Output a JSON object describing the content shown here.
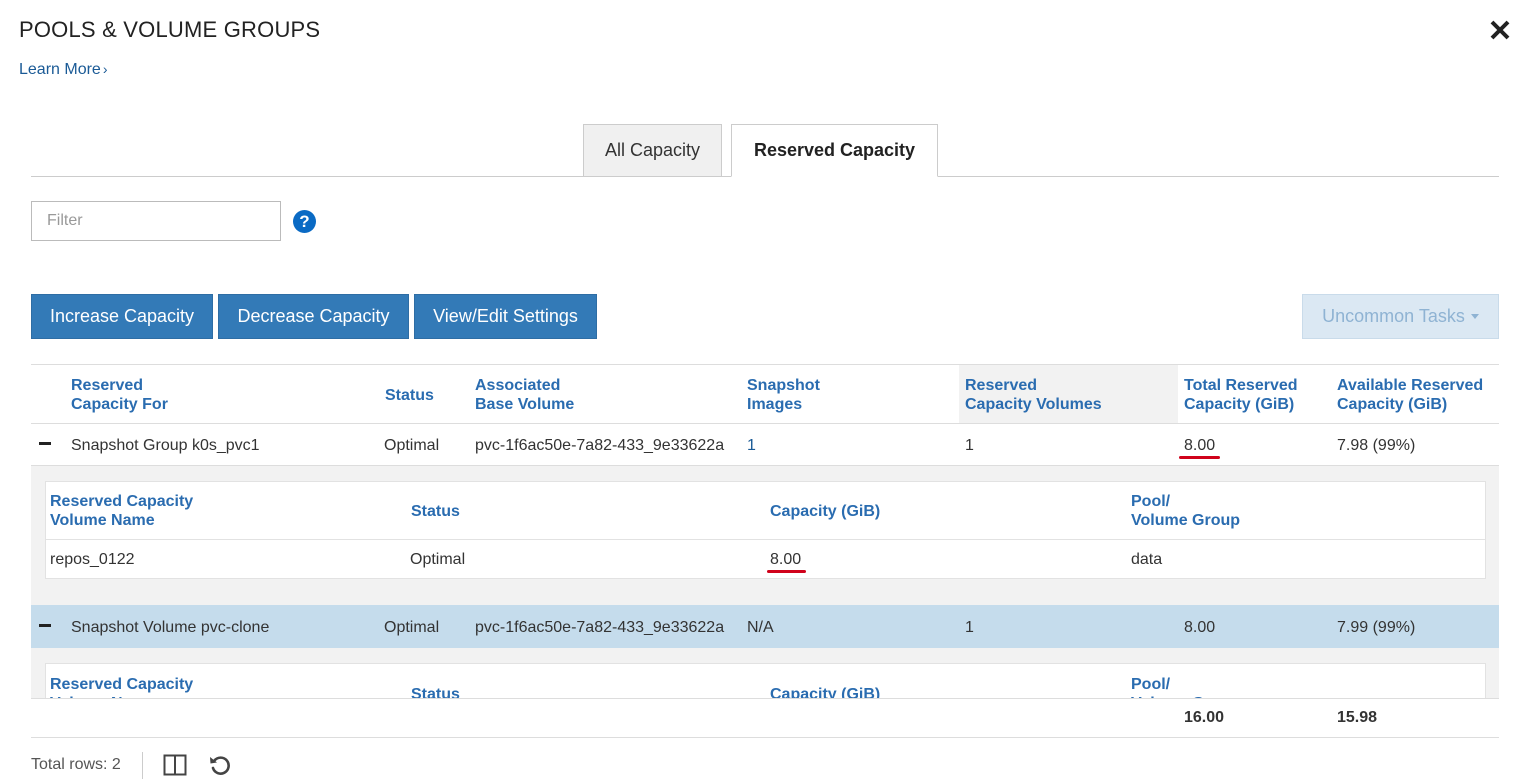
{
  "header": {
    "title": "POOLS & VOLUME GROUPS",
    "learn_more": "Learn More",
    "learn_more_chevron": "›"
  },
  "tabs": [
    {
      "label": "All Capacity",
      "active": false
    },
    {
      "label": "Reserved Capacity",
      "active": true
    }
  ],
  "filter": {
    "placeholder": "Filter",
    "value": ""
  },
  "help_icon_label": "?",
  "toolbar": {
    "increase": "Increase Capacity",
    "decrease": "Decrease Capacity",
    "view_edit": "View/Edit Settings",
    "uncommon": "Uncommon Tasks"
  },
  "table": {
    "columns": [
      {
        "line1": "Reserved",
        "line2": "Capacity For"
      },
      {
        "line1": "Status",
        "line2": ""
      },
      {
        "line1": "Associated",
        "line2": "Base Volume"
      },
      {
        "line1": "Snapshot",
        "line2": "Images"
      },
      {
        "line1": "Reserved",
        "line2": "Capacity Volumes"
      },
      {
        "line1": "Total Reserved",
        "line2": "Capacity (GiB)"
      },
      {
        "line1": "Available Reserved",
        "line2": "Capacity (GiB)"
      }
    ],
    "rows": [
      {
        "expanded": true,
        "capacity_for": "Snapshot Group k0s_pvc1",
        "status": "Optimal",
        "base_volume": "pvc-1f6ac50e-7a82-433_9e33622a",
        "snapshot_images": "1",
        "capacity_volumes": "1",
        "total_reserved": "8.00",
        "available_reserved": "7.98 (99%)"
      },
      {
        "expanded": true,
        "capacity_for": "Snapshot Volume pvc-clone",
        "status": "Optimal",
        "base_volume": "pvc-1f6ac50e-7a82-433_9e33622a",
        "snapshot_images": "N/A",
        "capacity_volumes": "1",
        "total_reserved": "8.00",
        "available_reserved": "7.99 (99%)"
      }
    ],
    "detail": {
      "columns": [
        {
          "line1": "Reserved Capacity",
          "line2": "Volume Name"
        },
        {
          "line1": "Status",
          "line2": ""
        },
        {
          "line1": "Capacity (GiB)",
          "line2": ""
        },
        {
          "line1": "Pool/",
          "line2": "Volume Group"
        }
      ],
      "row": {
        "name": "repos_0122",
        "status": "Optimal",
        "capacity": "8.00",
        "pool": "data"
      }
    },
    "totals": {
      "total_reserved": "16.00",
      "available_reserved": "15.98"
    }
  },
  "footer": {
    "total_rows": "Total rows: 2"
  },
  "colors": {
    "primary_button": "#337ab7",
    "header_link": "#2a6cb0",
    "selected_row": "#c5dcec",
    "highlight_underline": "#d0021b"
  }
}
